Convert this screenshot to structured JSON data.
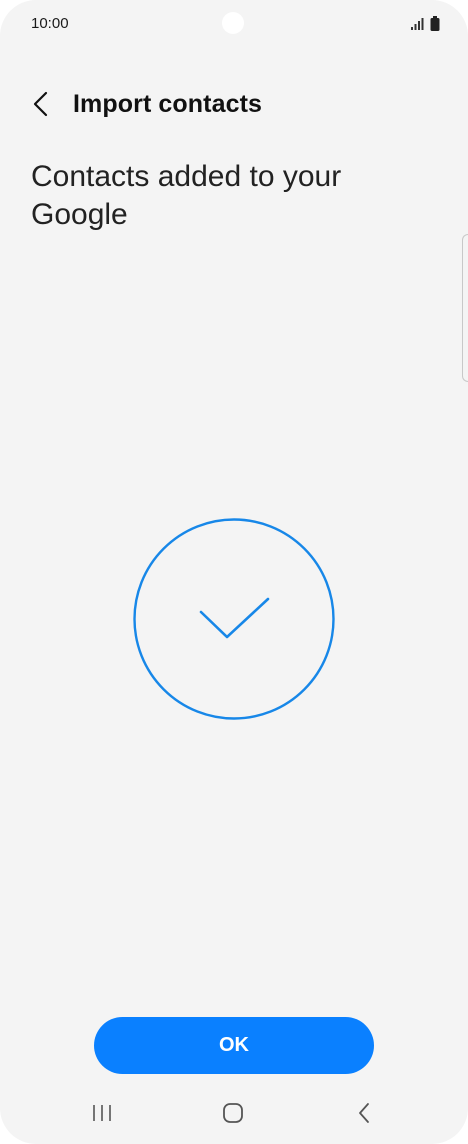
{
  "status_bar": {
    "time": "10:00",
    "icons": [
      "signal-icon",
      "battery-icon"
    ]
  },
  "header": {
    "back_icon": "chevron-left-icon",
    "title": "Import contacts"
  },
  "content": {
    "heading": "Contacts added to your Google",
    "status_icon": "checkmark-circle-icon"
  },
  "actions": {
    "ok_label": "OK"
  },
  "nav_bar": {
    "recents_icon": "recents-icon",
    "home_icon": "home-icon",
    "back_icon": "back-icon"
  },
  "colors": {
    "accent": "#0a80ff",
    "success_stroke": "#1787e8",
    "background": "#f4f4f4",
    "text_primary": "#111111"
  }
}
